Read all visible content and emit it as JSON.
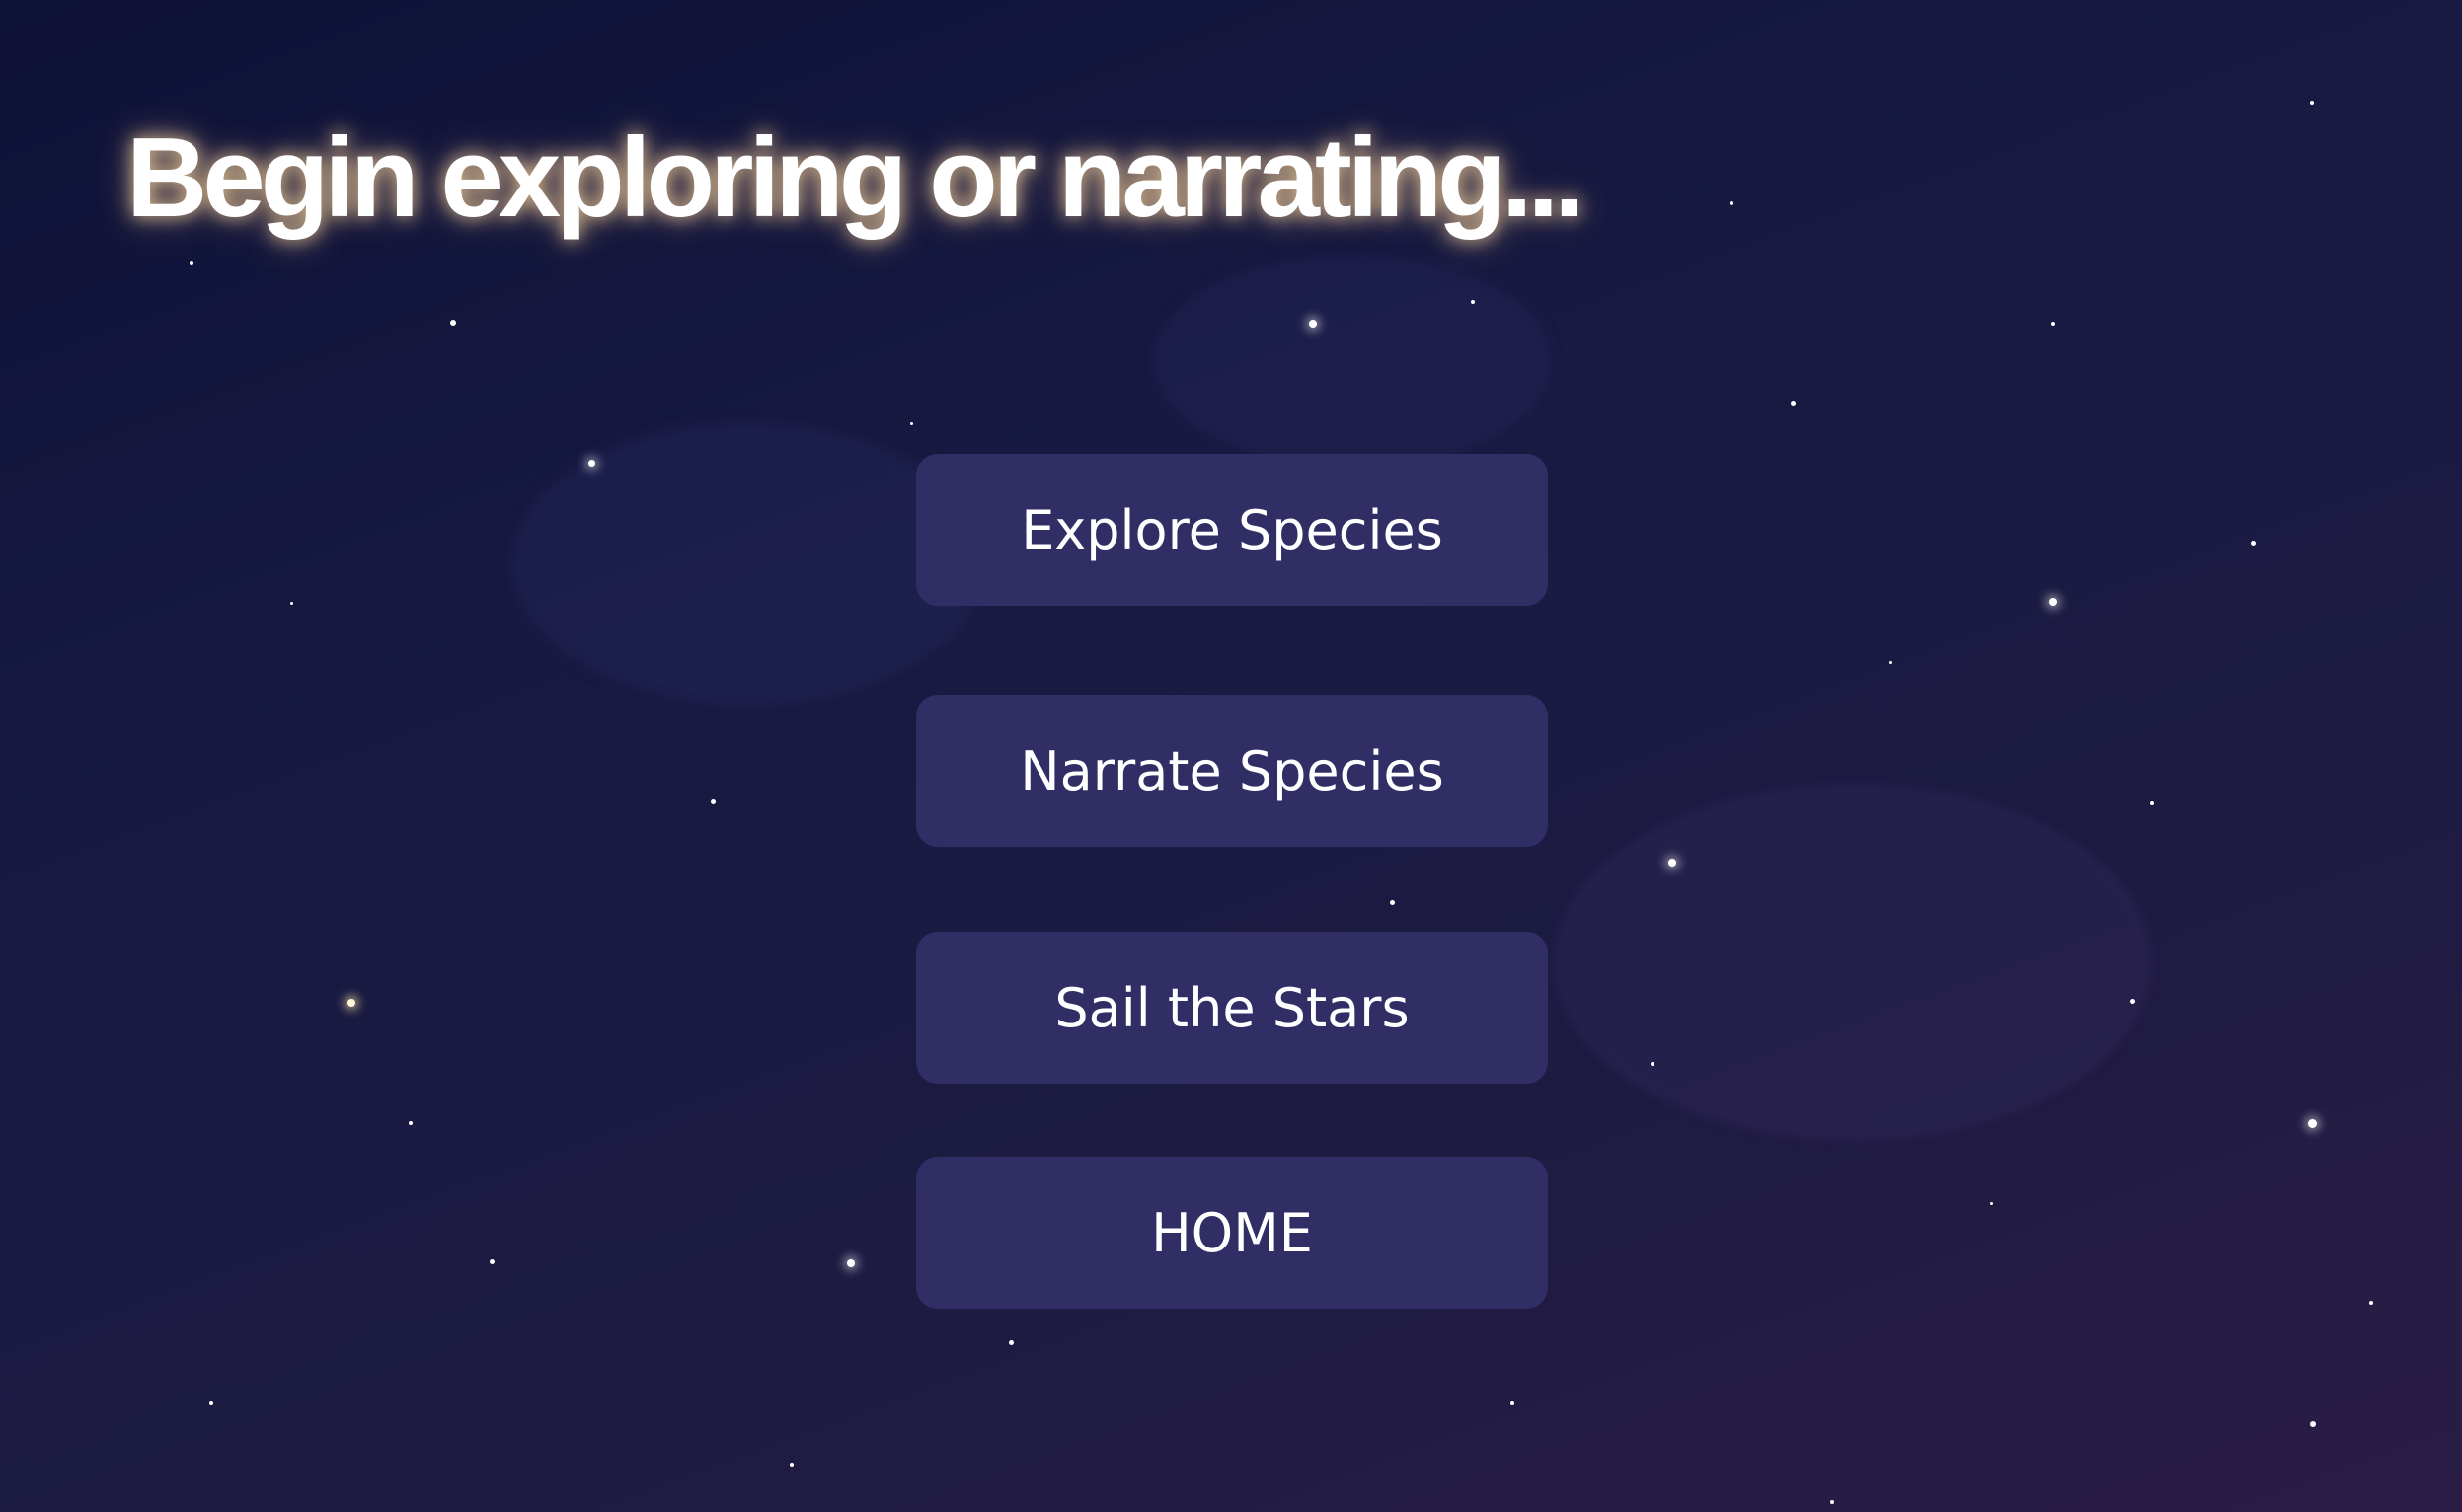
{
  "screen": {
    "title": "Begin exploring or narrating...",
    "accent_color": "#312e66",
    "background_color": "#181a42"
  },
  "menu": {
    "items": [
      {
        "label": "Explore Species"
      },
      {
        "label": "Narrate Species"
      },
      {
        "label": "Sail the Stars"
      },
      {
        "label": "HOME"
      }
    ]
  }
}
